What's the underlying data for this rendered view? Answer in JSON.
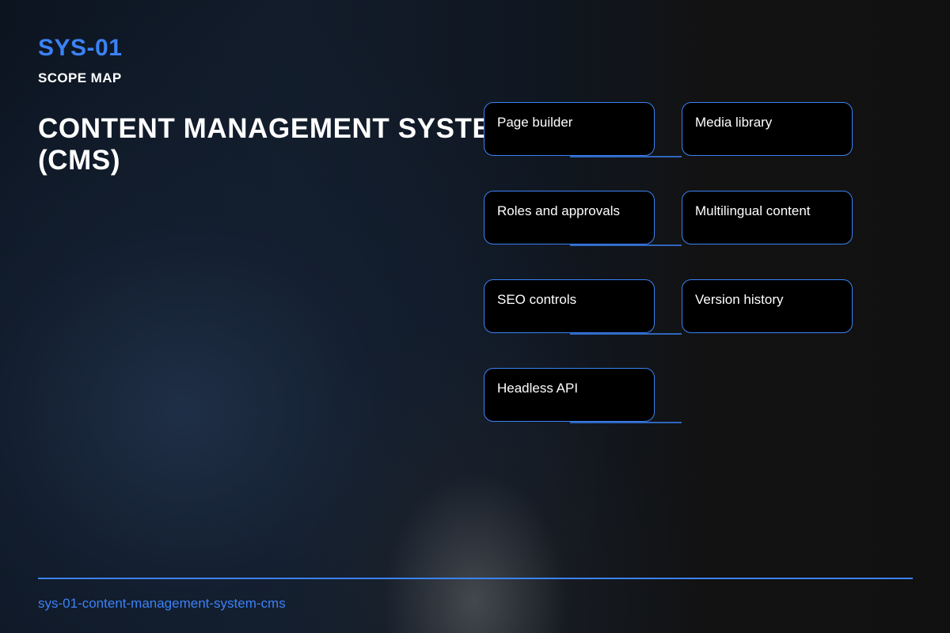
{
  "header": {
    "code": "SYS-01",
    "kicker": "SCOPE MAP",
    "title": "CONTENT MANAGEMENT SYSTEM (CMS)"
  },
  "nodes": [
    {
      "label": "Page builder"
    },
    {
      "label": "Media library"
    },
    {
      "label": "Roles and approvals"
    },
    {
      "label": "Multilingual content"
    },
    {
      "label": "SEO controls"
    },
    {
      "label": "Version history"
    },
    {
      "label": "Headless API"
    }
  ],
  "footer": {
    "slug": "sys-01-content-management-system-cms"
  },
  "colors": {
    "accent": "#3b82f6",
    "node_fill": "#000000",
    "text": "#ffffff"
  }
}
